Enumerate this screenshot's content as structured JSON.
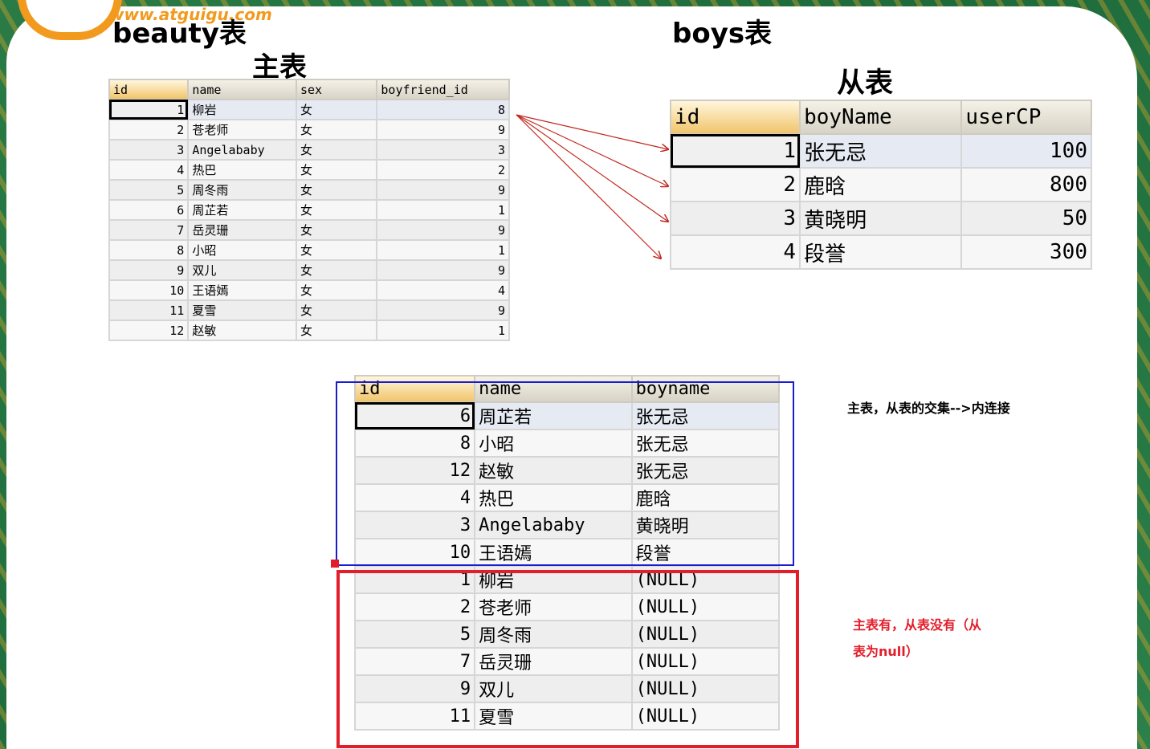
{
  "brand": {
    "site": "www.atguigu.com"
  },
  "labels": {
    "beauty_title": "beauty表",
    "main_table": "主表",
    "boys_title": "boys表",
    "sub_table": "从表"
  },
  "beauty": {
    "columns": [
      "id",
      "name",
      "sex",
      "boyfriend_id"
    ],
    "rows": [
      [
        "1",
        "柳岩",
        "女",
        "8"
      ],
      [
        "2",
        "苍老师",
        "女",
        "9"
      ],
      [
        "3",
        "Angelababy",
        "女",
        "3"
      ],
      [
        "4",
        "热巴",
        "女",
        "2"
      ],
      [
        "5",
        "周冬雨",
        "女",
        "9"
      ],
      [
        "6",
        "周芷若",
        "女",
        "1"
      ],
      [
        "7",
        "岳灵珊",
        "女",
        "9"
      ],
      [
        "8",
        "小昭",
        "女",
        "1"
      ],
      [
        "9",
        "双儿",
        "女",
        "9"
      ],
      [
        "10",
        "王语嫣",
        "女",
        "4"
      ],
      [
        "11",
        "夏雪",
        "女",
        "9"
      ],
      [
        "12",
        "赵敏",
        "女",
        "1"
      ]
    ]
  },
  "boys": {
    "columns": [
      "id",
      "boyName",
      "userCP"
    ],
    "rows": [
      [
        "1",
        "张无忌",
        "100"
      ],
      [
        "2",
        "鹿晗",
        "800"
      ],
      [
        "3",
        "黄晓明",
        "50"
      ],
      [
        "4",
        "段誉",
        "300"
      ]
    ]
  },
  "join_result": {
    "columns": [
      "id",
      "name",
      "boyname"
    ],
    "rows": [
      [
        "6",
        "周芷若",
        "张无忌"
      ],
      [
        "8",
        "小昭",
        "张无忌"
      ],
      [
        "12",
        "赵敏",
        "张无忌"
      ],
      [
        "4",
        "热巴",
        "鹿晗"
      ],
      [
        "3",
        "Angelababy",
        "黄晓明"
      ],
      [
        "10",
        "王语嫣",
        "段誉"
      ],
      [
        "1",
        "柳岩",
        "(NULL)"
      ],
      [
        "2",
        "苍老师",
        "(NULL)"
      ],
      [
        "5",
        "周冬雨",
        "(NULL)"
      ],
      [
        "7",
        "岳灵珊",
        "(NULL)"
      ],
      [
        "9",
        "双儿",
        "(NULL)"
      ],
      [
        "11",
        "夏雪",
        "(NULL)"
      ]
    ]
  },
  "notes": {
    "inner_join": "主表，从表的交集-->内连接",
    "outer_null_line1": "主表有，从表没有（从",
    "outer_null_line2": "表为null）"
  },
  "colors": {
    "inner_box": "#1b1bd0",
    "outer_box": "#e21e2b",
    "arrow": "#c0281e",
    "logo": "#f29a1e"
  }
}
